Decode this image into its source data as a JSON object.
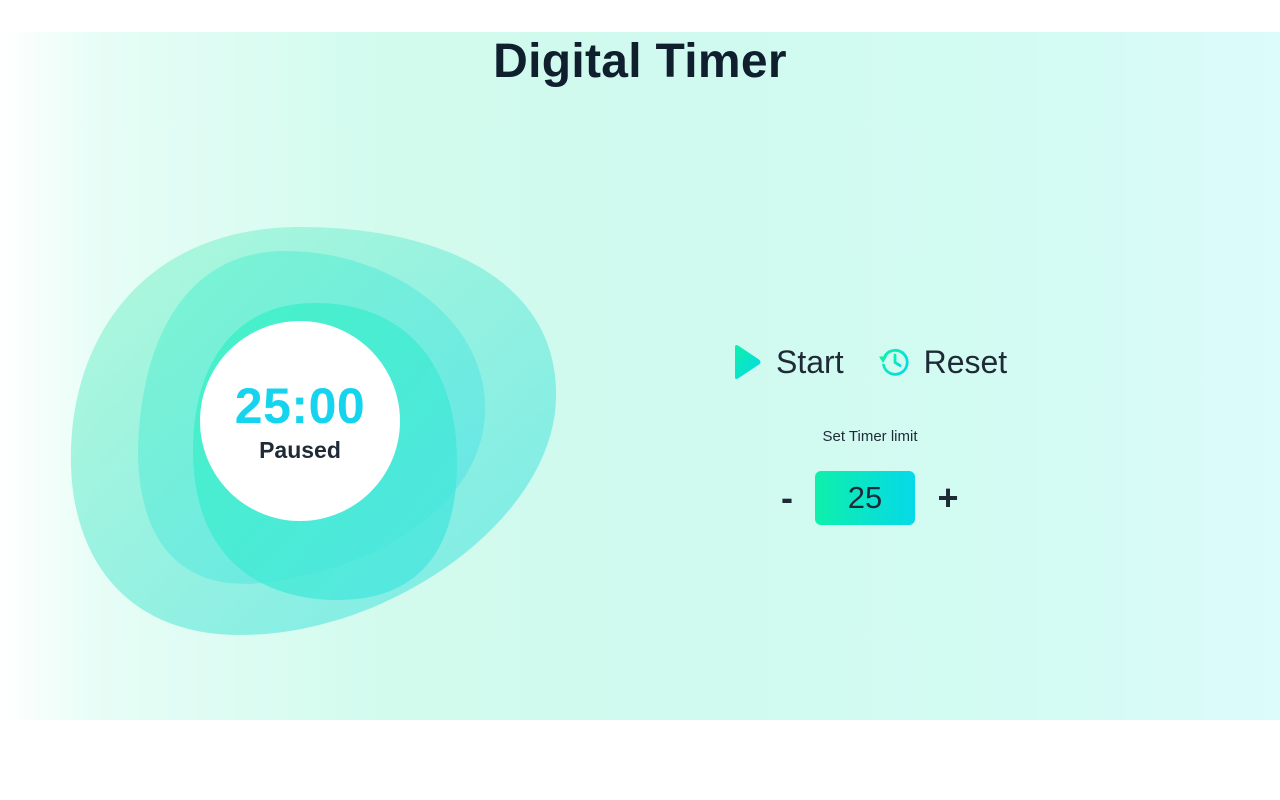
{
  "app": {
    "title": "Digital Timer"
  },
  "timer": {
    "display": "25:00",
    "status": "Paused"
  },
  "controls": {
    "start_label": "Start",
    "reset_label": "Reset"
  },
  "limit": {
    "label": "Set Timer limit",
    "value": "25",
    "decrement_label": "-",
    "increment_label": "+"
  },
  "icons": {
    "start": "play-icon",
    "reset": "history-icon"
  },
  "colors": {
    "accent_green": "#0ef0ab",
    "accent_cyan": "#17d4ee",
    "text_dark": "#1f2a37",
    "title_dark": "#0f1f2e"
  }
}
